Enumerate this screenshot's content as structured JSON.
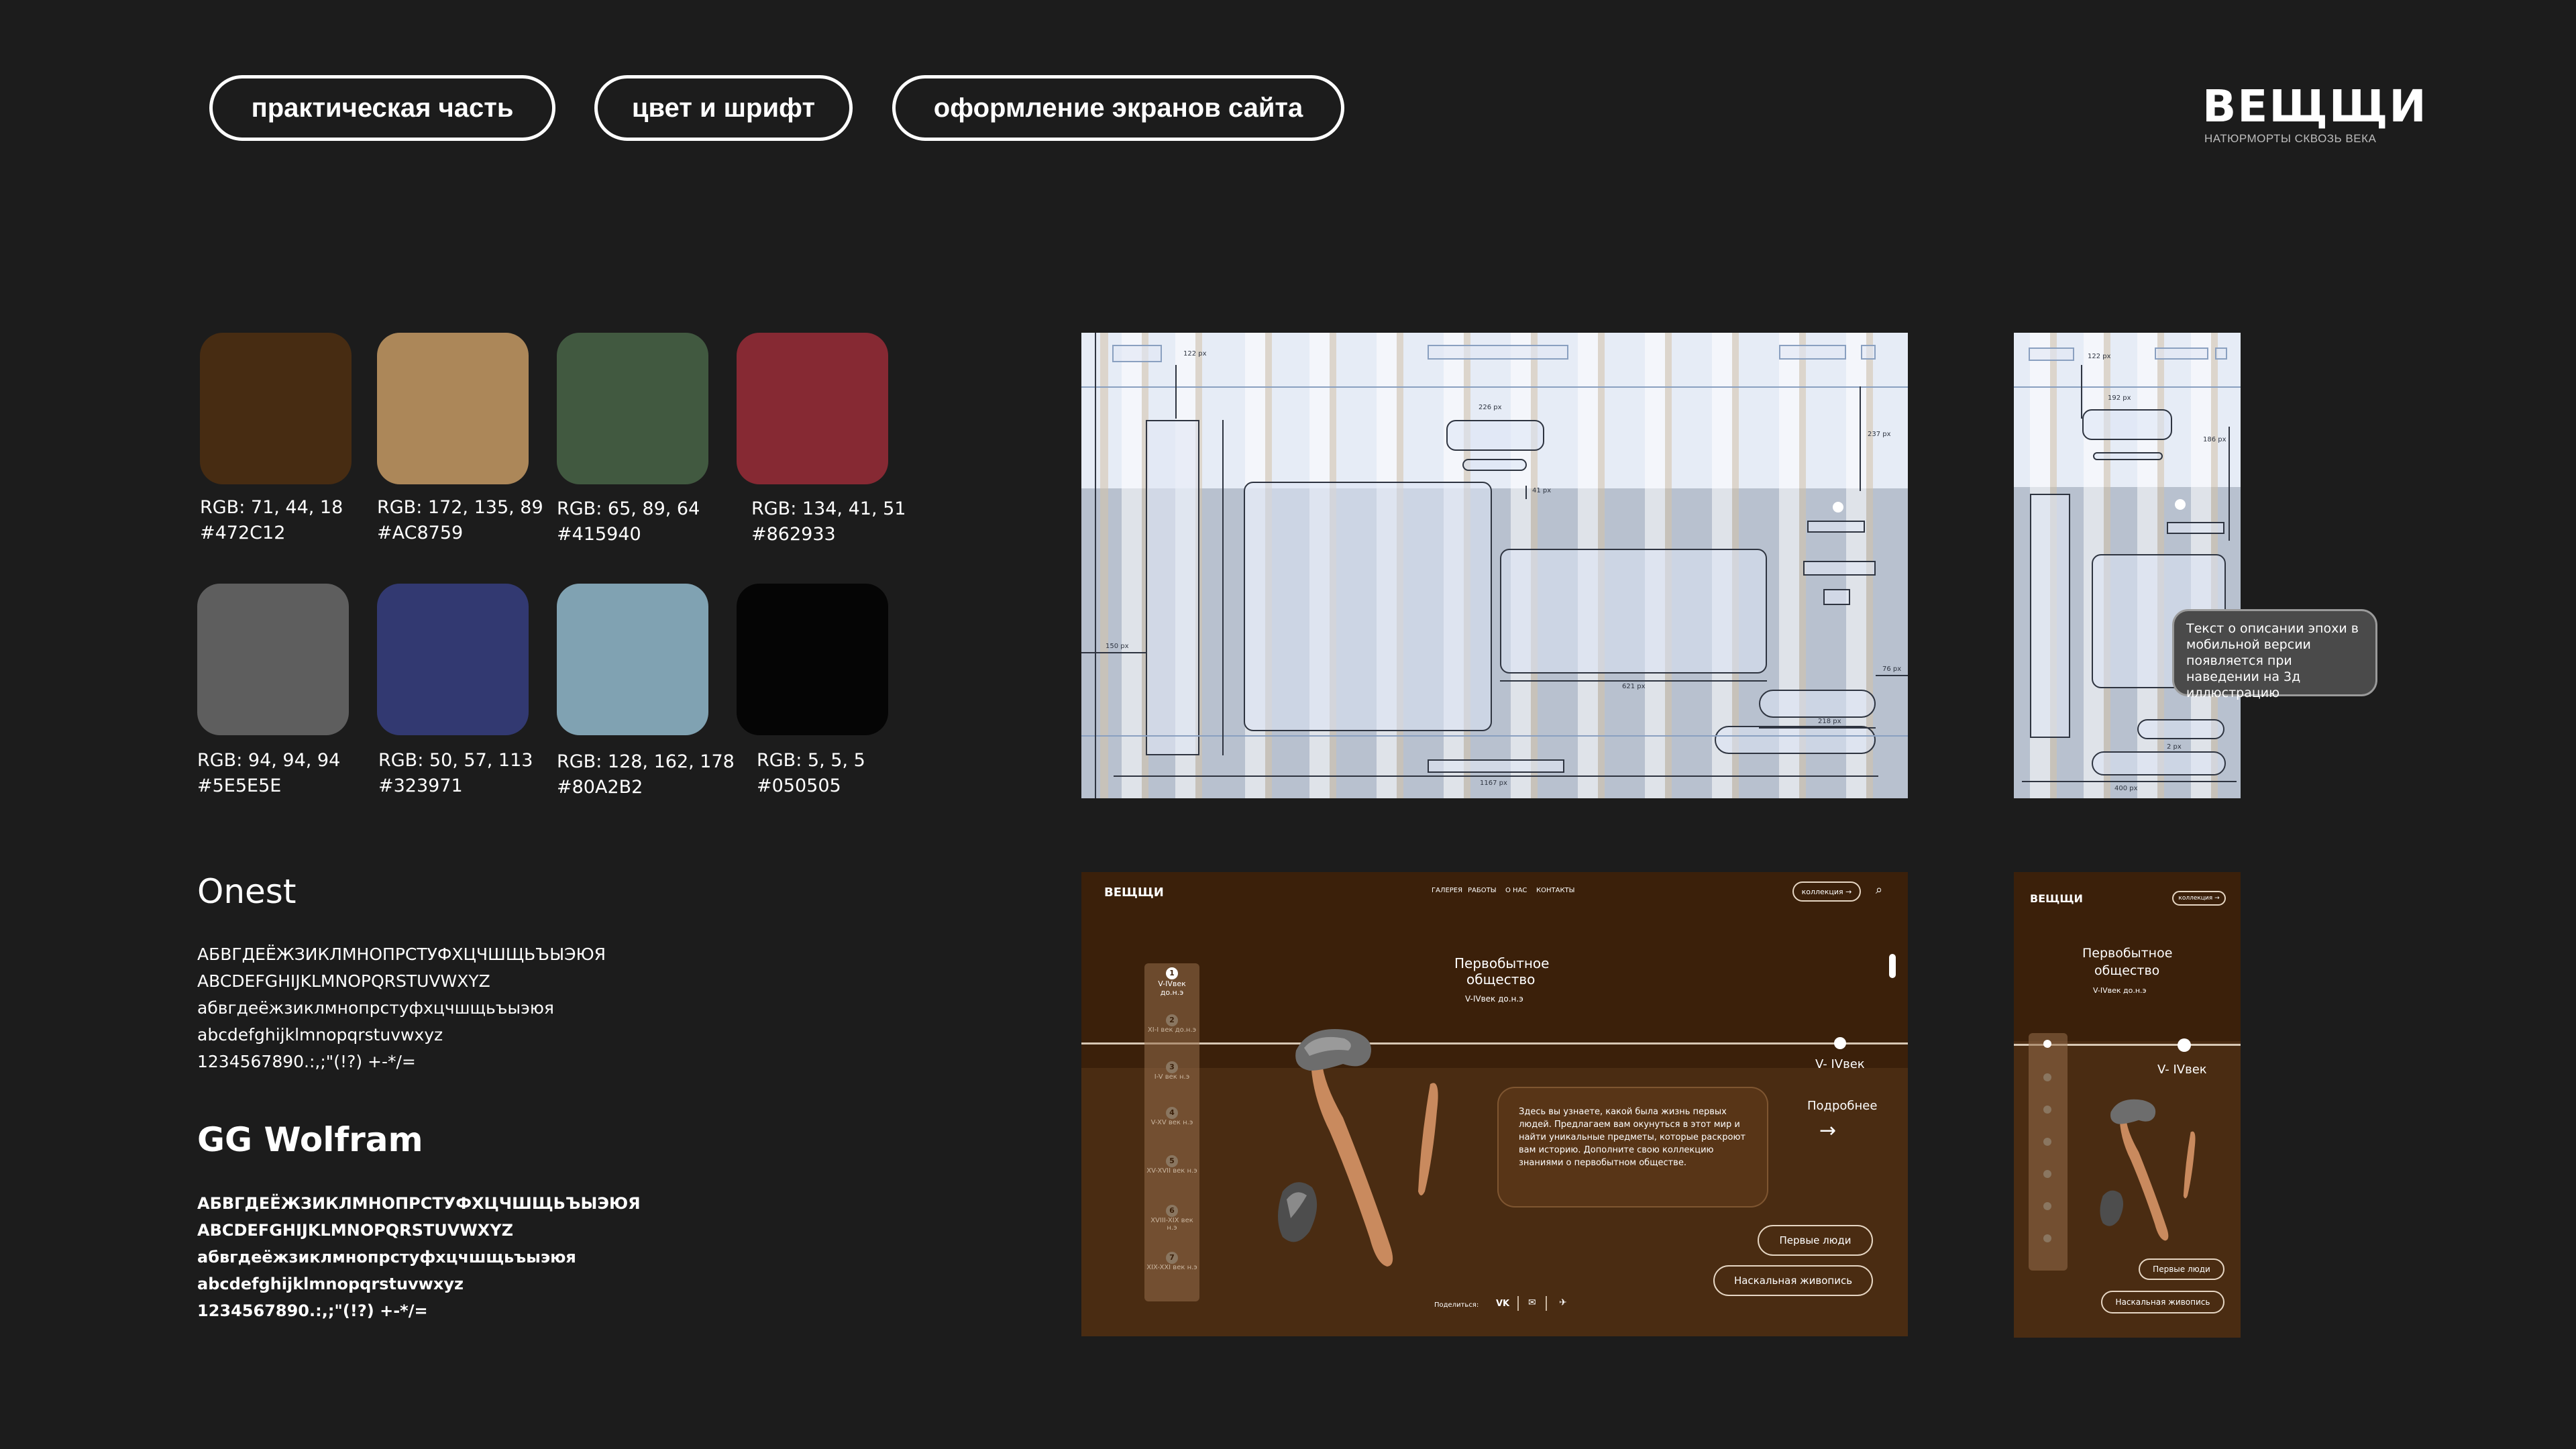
{
  "nav": {
    "tabs": [
      "практическая часть",
      "цвет и шрифт",
      "оформление экранов сайта"
    ]
  },
  "logo": {
    "title": "ВЕЩЩИ",
    "subtitle": "НАТЮРМОРТЫ СКВОЗЬ ВЕКА"
  },
  "palette": [
    {
      "rgb": "RGB: 71, 44, 18",
      "hex": "#472C12",
      "color": "#472c12"
    },
    {
      "rgb": "RGB: 172, 135, 89",
      "hex": "#AC8759",
      "color": "#ac8759"
    },
    {
      "rgb": "RGB: 65, 89, 64",
      "hex": "#415940",
      "color": "#415940"
    },
    {
      "rgb": "RGB: 134, 41, 51",
      "hex": "#862933",
      "color": "#862933"
    },
    {
      "rgb": "RGB: 94, 94, 94",
      "hex": "#5E5E5E",
      "color": "#5e5e5e"
    },
    {
      "rgb": "RGB: 50, 57, 113",
      "hex": "#323971",
      "color": "#323971"
    },
    {
      "rgb": "RGB: 128, 162, 178",
      "hex": "#80A2B2",
      "color": "#80a2b2"
    },
    {
      "rgb": "RGB: 5, 5, 5",
      "hex": "#050505",
      "color": "#050505"
    }
  ],
  "fonts": [
    {
      "name": "Onest",
      "samples": [
        "АБВГДЕЁЖЗИКЛМНОПРСТУФХЦЧШЩЬЪЫЭЮЯ",
        "ABCDEFGHIJKLMNOPQRSTUVWXYZ",
        "абвгдеёжзиклмнопрстуфхцчшщьъыэюя",
        "abcdefghijklmnopqrstuvwxyz",
        "1234567890.:,;\"(!?) +-*/="
      ]
    },
    {
      "name": "GG Wolfram",
      "samples": [
        "АБВГДЕЁЖЗИКЛМНОПРСТУФХЦЧШЩЬЪЫЭЮЯ",
        "ABCDEFGHIJKLMNOPQRSTUVWXYZ",
        "абвгдеёжзиклмнопрстуфхцчшщьъыэюя",
        "abcdefghijklmnopqrstuvwxyz",
        "1234567890.:,;\"(!?) +-*/="
      ]
    }
  ],
  "wireframe_desktop": {
    "dims": [
      "122 px",
      "226 px",
      "237 px",
      "41 px",
      "150 px",
      "621 px",
      "218 px",
      "76 px",
      "1167 px"
    ]
  },
  "wireframe_mobile": {
    "dims": [
      "122 px",
      "192 px",
      "186 px",
      "2 px",
      "400 px"
    ]
  },
  "tooltip": "Текст о описании эпохи в мобильной версии появляется при наведении на 3д иллюстрацию",
  "mockup_desktop": {
    "logo": "ВЕЩЩИ",
    "menu": [
      "ГАЛЕРЕЯ",
      "РАБОТЫ",
      "О НАС",
      "КОНТАКТЫ"
    ],
    "collection_button": "коллекция",
    "title_line1": "Первобытное",
    "title_line2": "общество",
    "period": "V-IVвек до.н.э",
    "timeline_label": "V- IVвек",
    "more": "Подробнее",
    "description": "Здесь вы узнаете, какой была жизнь первых людей. Предлагаем вам окунуться в этот мир и найти уникальные предметы, которые раскроют вам историю. Дополните свою коллекцию знаниями о первобытном обществе.",
    "btn_first_people": "Первые люди",
    "btn_cave_painting": "Наскальная живопись",
    "share": "Поделиться:",
    "eras": [
      {
        "num": "1",
        "label": "V-IVвек до.н.э"
      },
      {
        "num": "2",
        "label": "XI-I век до.н.э"
      },
      {
        "num": "3",
        "label": "I-V век н.э"
      },
      {
        "num": "4",
        "label": "V-XV век н.э"
      },
      {
        "num": "5",
        "label": "XV-XVII век н.э"
      },
      {
        "num": "6",
        "label": "XVIII-XIX век н.э"
      },
      {
        "num": "7",
        "label": "XIX-XXI век н.э"
      }
    ]
  },
  "mockup_mobile": {
    "logo": "ВЕЩЩИ",
    "collection_button": "коллекция",
    "title_line1": "Первобытное",
    "title_line2": "общество",
    "period": "V-IVвек до.н.э",
    "timeline_label": "V- IVвек",
    "btn_first_people": "Первые люди",
    "btn_cave_painting": "Наскальная живопись"
  }
}
